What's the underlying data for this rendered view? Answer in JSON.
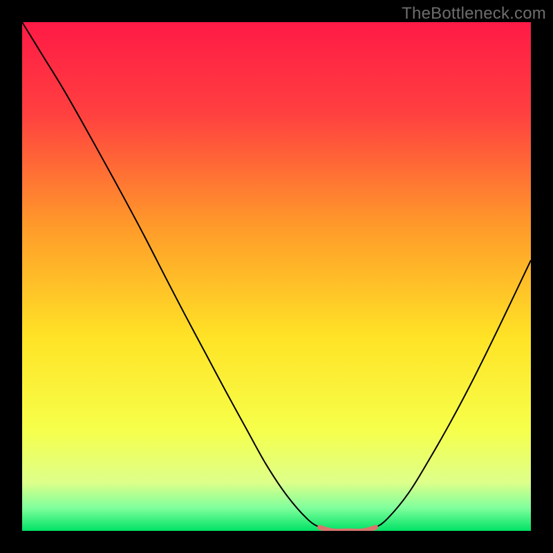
{
  "watermark": "TheBottleneck.com",
  "chart_data": {
    "type": "line",
    "title": "",
    "xlabel": "",
    "ylabel": "",
    "xlim": [
      0,
      100
    ],
    "ylim": [
      0,
      100
    ],
    "grid": false,
    "legend": false,
    "background_gradient_stops": [
      {
        "offset": 0.0,
        "color": "#ff1a46"
      },
      {
        "offset": 0.18,
        "color": "#ff4040"
      },
      {
        "offset": 0.4,
        "color": "#ff9a2a"
      },
      {
        "offset": 0.62,
        "color": "#ffe326"
      },
      {
        "offset": 0.8,
        "color": "#f6ff4a"
      },
      {
        "offset": 0.905,
        "color": "#ddff8a"
      },
      {
        "offset": 0.955,
        "color": "#7fff9c"
      },
      {
        "offset": 1.0,
        "color": "#00e265"
      }
    ],
    "series": [
      {
        "name": "bottleneck-curve",
        "stroke": "#000000",
        "stroke_width": 2.0,
        "x": [
          0.0,
          4.0,
          8.0,
          12.0,
          16.0,
          20.0,
          24.0,
          28.0,
          32.0,
          36.0,
          40.0,
          44.0,
          48.0,
          52.0,
          56.0,
          58.5,
          61.0,
          64.0,
          67.0,
          69.5,
          72.0,
          76.0,
          80.0,
          84.0,
          88.0,
          92.0,
          96.0,
          100.0
        ],
        "values": [
          100.0,
          93.5,
          87.0,
          80.0,
          72.8,
          65.5,
          58.0,
          50.2,
          42.5,
          35.0,
          27.5,
          20.2,
          13.0,
          7.0,
          2.4,
          0.7,
          0.0,
          0.0,
          0.0,
          0.7,
          2.6,
          7.5,
          14.0,
          21.0,
          28.5,
          36.5,
          44.8,
          53.2
        ]
      },
      {
        "name": "optimal-band",
        "stroke": "#d8766d",
        "stroke_width": 7.0,
        "x": [
          58.5,
          61.0,
          64.0,
          67.0,
          69.5
        ],
        "values": [
          0.7,
          0.0,
          0.0,
          0.0,
          0.7
        ]
      }
    ]
  }
}
